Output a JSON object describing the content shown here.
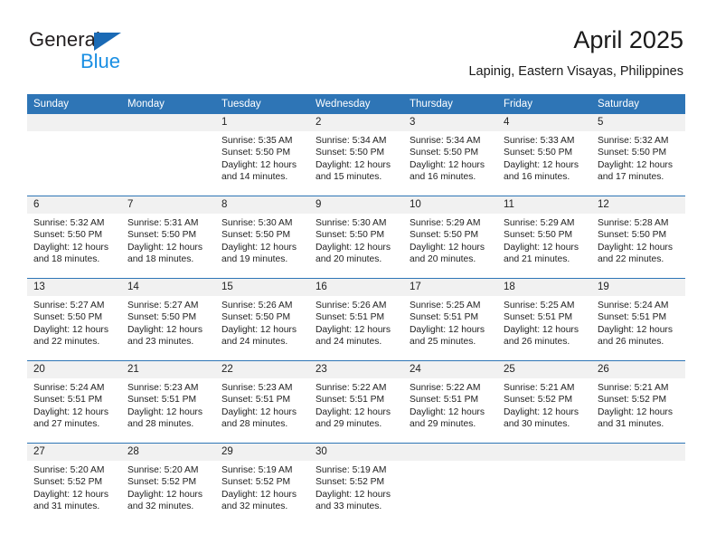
{
  "brand": {
    "name_part1": "General",
    "name_part2": "Blue",
    "logo_icon": "triangle-logo-icon"
  },
  "header": {
    "title": "April 2025",
    "subtitle": "Lapinig, Eastern Visayas, Philippines"
  },
  "colors": {
    "header_blue": "#2e75b6",
    "brand_blue": "#1a8fe3",
    "logo_blue": "#1a6ab5",
    "daynum_band": "#f1f1f1",
    "text": "#222222"
  },
  "weekday_headers": [
    "Sunday",
    "Monday",
    "Tuesday",
    "Wednesday",
    "Thursday",
    "Friday",
    "Saturday"
  ],
  "weeks": [
    [
      {
        "day": "",
        "sunrise": "",
        "sunset": "",
        "daylight": ""
      },
      {
        "day": "",
        "sunrise": "",
        "sunset": "",
        "daylight": ""
      },
      {
        "day": "1",
        "sunrise": "Sunrise: 5:35 AM",
        "sunset": "Sunset: 5:50 PM",
        "daylight": "Daylight: 12 hours and 14 minutes."
      },
      {
        "day": "2",
        "sunrise": "Sunrise: 5:34 AM",
        "sunset": "Sunset: 5:50 PM",
        "daylight": "Daylight: 12 hours and 15 minutes."
      },
      {
        "day": "3",
        "sunrise": "Sunrise: 5:34 AM",
        "sunset": "Sunset: 5:50 PM",
        "daylight": "Daylight: 12 hours and 16 minutes."
      },
      {
        "day": "4",
        "sunrise": "Sunrise: 5:33 AM",
        "sunset": "Sunset: 5:50 PM",
        "daylight": "Daylight: 12 hours and 16 minutes."
      },
      {
        "day": "5",
        "sunrise": "Sunrise: 5:32 AM",
        "sunset": "Sunset: 5:50 PM",
        "daylight": "Daylight: 12 hours and 17 minutes."
      }
    ],
    [
      {
        "day": "6",
        "sunrise": "Sunrise: 5:32 AM",
        "sunset": "Sunset: 5:50 PM",
        "daylight": "Daylight: 12 hours and 18 minutes."
      },
      {
        "day": "7",
        "sunrise": "Sunrise: 5:31 AM",
        "sunset": "Sunset: 5:50 PM",
        "daylight": "Daylight: 12 hours and 18 minutes."
      },
      {
        "day": "8",
        "sunrise": "Sunrise: 5:30 AM",
        "sunset": "Sunset: 5:50 PM",
        "daylight": "Daylight: 12 hours and 19 minutes."
      },
      {
        "day": "9",
        "sunrise": "Sunrise: 5:30 AM",
        "sunset": "Sunset: 5:50 PM",
        "daylight": "Daylight: 12 hours and 20 minutes."
      },
      {
        "day": "10",
        "sunrise": "Sunrise: 5:29 AM",
        "sunset": "Sunset: 5:50 PM",
        "daylight": "Daylight: 12 hours and 20 minutes."
      },
      {
        "day": "11",
        "sunrise": "Sunrise: 5:29 AM",
        "sunset": "Sunset: 5:50 PM",
        "daylight": "Daylight: 12 hours and 21 minutes."
      },
      {
        "day": "12",
        "sunrise": "Sunrise: 5:28 AM",
        "sunset": "Sunset: 5:50 PM",
        "daylight": "Daylight: 12 hours and 22 minutes."
      }
    ],
    [
      {
        "day": "13",
        "sunrise": "Sunrise: 5:27 AM",
        "sunset": "Sunset: 5:50 PM",
        "daylight": "Daylight: 12 hours and 22 minutes."
      },
      {
        "day": "14",
        "sunrise": "Sunrise: 5:27 AM",
        "sunset": "Sunset: 5:50 PM",
        "daylight": "Daylight: 12 hours and 23 minutes."
      },
      {
        "day": "15",
        "sunrise": "Sunrise: 5:26 AM",
        "sunset": "Sunset: 5:50 PM",
        "daylight": "Daylight: 12 hours and 24 minutes."
      },
      {
        "day": "16",
        "sunrise": "Sunrise: 5:26 AM",
        "sunset": "Sunset: 5:51 PM",
        "daylight": "Daylight: 12 hours and 24 minutes."
      },
      {
        "day": "17",
        "sunrise": "Sunrise: 5:25 AM",
        "sunset": "Sunset: 5:51 PM",
        "daylight": "Daylight: 12 hours and 25 minutes."
      },
      {
        "day": "18",
        "sunrise": "Sunrise: 5:25 AM",
        "sunset": "Sunset: 5:51 PM",
        "daylight": "Daylight: 12 hours and 26 minutes."
      },
      {
        "day": "19",
        "sunrise": "Sunrise: 5:24 AM",
        "sunset": "Sunset: 5:51 PM",
        "daylight": "Daylight: 12 hours and 26 minutes."
      }
    ],
    [
      {
        "day": "20",
        "sunrise": "Sunrise: 5:24 AM",
        "sunset": "Sunset: 5:51 PM",
        "daylight": "Daylight: 12 hours and 27 minutes."
      },
      {
        "day": "21",
        "sunrise": "Sunrise: 5:23 AM",
        "sunset": "Sunset: 5:51 PM",
        "daylight": "Daylight: 12 hours and 28 minutes."
      },
      {
        "day": "22",
        "sunrise": "Sunrise: 5:23 AM",
        "sunset": "Sunset: 5:51 PM",
        "daylight": "Daylight: 12 hours and 28 minutes."
      },
      {
        "day": "23",
        "sunrise": "Sunrise: 5:22 AM",
        "sunset": "Sunset: 5:51 PM",
        "daylight": "Daylight: 12 hours and 29 minutes."
      },
      {
        "day": "24",
        "sunrise": "Sunrise: 5:22 AM",
        "sunset": "Sunset: 5:51 PM",
        "daylight": "Daylight: 12 hours and 29 minutes."
      },
      {
        "day": "25",
        "sunrise": "Sunrise: 5:21 AM",
        "sunset": "Sunset: 5:52 PM",
        "daylight": "Daylight: 12 hours and 30 minutes."
      },
      {
        "day": "26",
        "sunrise": "Sunrise: 5:21 AM",
        "sunset": "Sunset: 5:52 PM",
        "daylight": "Daylight: 12 hours and 31 minutes."
      }
    ],
    [
      {
        "day": "27",
        "sunrise": "Sunrise: 5:20 AM",
        "sunset": "Sunset: 5:52 PM",
        "daylight": "Daylight: 12 hours and 31 minutes."
      },
      {
        "day": "28",
        "sunrise": "Sunrise: 5:20 AM",
        "sunset": "Sunset: 5:52 PM",
        "daylight": "Daylight: 12 hours and 32 minutes."
      },
      {
        "day": "29",
        "sunrise": "Sunrise: 5:19 AM",
        "sunset": "Sunset: 5:52 PM",
        "daylight": "Daylight: 12 hours and 32 minutes."
      },
      {
        "day": "30",
        "sunrise": "Sunrise: 5:19 AM",
        "sunset": "Sunset: 5:52 PM",
        "daylight": "Daylight: 12 hours and 33 minutes."
      },
      {
        "day": "",
        "sunrise": "",
        "sunset": "",
        "daylight": ""
      },
      {
        "day": "",
        "sunrise": "",
        "sunset": "",
        "daylight": ""
      },
      {
        "day": "",
        "sunrise": "",
        "sunset": "",
        "daylight": ""
      }
    ]
  ]
}
